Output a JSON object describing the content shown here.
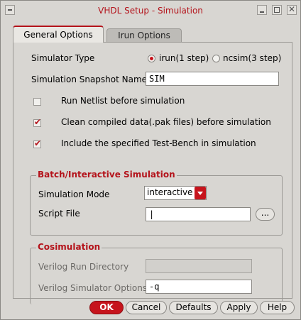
{
  "window": {
    "title": "VHDL Setup - Simulation"
  },
  "tabs": [
    {
      "label": "General Options",
      "active": true
    },
    {
      "label": "Irun Options",
      "active": false
    }
  ],
  "general": {
    "simulator_type_label": "Simulator Type",
    "simulator_options": [
      {
        "label": "irun(1 step)",
        "selected": true
      },
      {
        "label": "ncsim(3 step)",
        "selected": false
      }
    ],
    "snapshot_label": "Simulation Snapshot Name",
    "snapshot_value": "SIM",
    "checks": [
      {
        "label": "Run Netlist before simulation",
        "checked": false
      },
      {
        "label": "Clean compiled data(.pak files) before simulation",
        "checked": true
      },
      {
        "label": "Include the specified Test-Bench in simulation",
        "checked": true
      }
    ]
  },
  "batch": {
    "title": "Batch/Interactive Simulation",
    "mode_label": "Simulation Mode",
    "mode_value": "interactive",
    "script_label": "Script File",
    "script_value": "|",
    "browse_label": "..."
  },
  "cosim": {
    "title": "Cosimulation",
    "run_dir_label": "Verilog Run Directory",
    "run_dir_value": "",
    "options_label": "Verilog Simulator Options",
    "options_value": "-q"
  },
  "buttons": {
    "ok": "OK",
    "cancel": "Cancel",
    "defaults": "Defaults",
    "apply": "Apply",
    "help": "Help"
  },
  "colors": {
    "accent": "#c6141c",
    "background": "#d8d6d2"
  }
}
